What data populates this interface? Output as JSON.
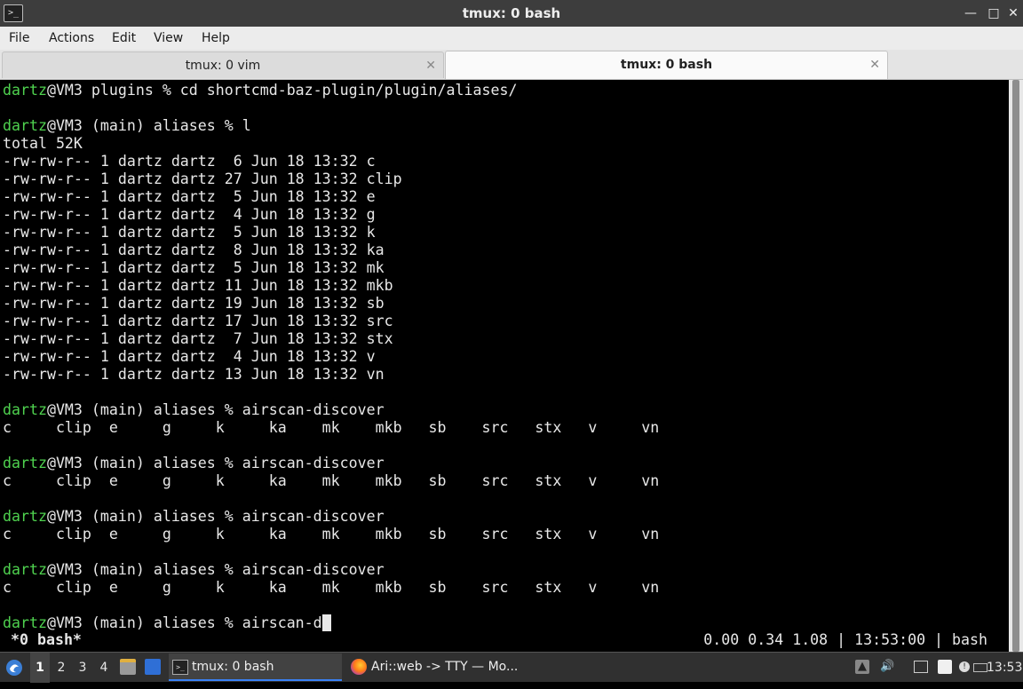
{
  "window": {
    "title": "tmux: 0 bash"
  },
  "menubar": [
    "File",
    "Actions",
    "Edit",
    "View",
    "Help"
  ],
  "tabs": [
    {
      "label": "tmux: 0 vim",
      "active": false
    },
    {
      "label": "tmux: 0 bash",
      "active": true
    }
  ],
  "terminal": {
    "lines": [
      {
        "user": "dartz",
        "rest": "@VM3 plugins % cd shortcmd-baz-plugin/plugin/aliases/"
      },
      {
        "text": ""
      },
      {
        "user": "dartz",
        "rest": "@VM3 (main) aliases % l"
      },
      {
        "text": "total 52K"
      },
      {
        "text": "-rw-rw-r-- 1 dartz dartz  6 Jun 18 13:32 c"
      },
      {
        "text": "-rw-rw-r-- 1 dartz dartz 27 Jun 18 13:32 clip"
      },
      {
        "text": "-rw-rw-r-- 1 dartz dartz  5 Jun 18 13:32 e"
      },
      {
        "text": "-rw-rw-r-- 1 dartz dartz  4 Jun 18 13:32 g"
      },
      {
        "text": "-rw-rw-r-- 1 dartz dartz  5 Jun 18 13:32 k"
      },
      {
        "text": "-rw-rw-r-- 1 dartz dartz  8 Jun 18 13:32 ka"
      },
      {
        "text": "-rw-rw-r-- 1 dartz dartz  5 Jun 18 13:32 mk"
      },
      {
        "text": "-rw-rw-r-- 1 dartz dartz 11 Jun 18 13:32 mkb"
      },
      {
        "text": "-rw-rw-r-- 1 dartz dartz 19 Jun 18 13:32 sb"
      },
      {
        "text": "-rw-rw-r-- 1 dartz dartz 17 Jun 18 13:32 src"
      },
      {
        "text": "-rw-rw-r-- 1 dartz dartz  7 Jun 18 13:32 stx"
      },
      {
        "text": "-rw-rw-r-- 1 dartz dartz  4 Jun 18 13:32 v"
      },
      {
        "text": "-rw-rw-r-- 1 dartz dartz 13 Jun 18 13:32 vn"
      },
      {
        "text": ""
      },
      {
        "user": "dartz",
        "rest": "@VM3 (main) aliases % airscan-discover"
      },
      {
        "text": "c     clip  e     g     k     ka    mk    mkb   sb    src   stx   v     vn"
      },
      {
        "text": ""
      },
      {
        "user": "dartz",
        "rest": "@VM3 (main) aliases % airscan-discover"
      },
      {
        "text": "c     clip  e     g     k     ka    mk    mkb   sb    src   stx   v     vn"
      },
      {
        "text": ""
      },
      {
        "user": "dartz",
        "rest": "@VM3 (main) aliases % airscan-discover"
      },
      {
        "text": "c     clip  e     g     k     ka    mk    mkb   sb    src   stx   v     vn"
      },
      {
        "text": ""
      },
      {
        "user": "dartz",
        "rest": "@VM3 (main) aliases % airscan-discover"
      },
      {
        "text": "c     clip  e     g     k     ka    mk    mkb   sb    src   stx   v     vn"
      },
      {
        "text": ""
      },
      {
        "user": "dartz",
        "rest": "@VM3 (main) aliases % airscan-d",
        "cursor": true
      }
    ],
    "status_left": "*0 bash*",
    "status_right": "0.00 0.34 1.08 | 13:53:00 | bash"
  },
  "taskbar": {
    "workspaces": [
      "1",
      "2",
      "3",
      "4"
    ],
    "active_workspace": "1",
    "tasks": [
      {
        "label": "tmux: 0 bash",
        "icon": "terminal-icon",
        "active": true
      },
      {
        "label": "Ari::web -> TTY — Mo...",
        "icon": "firefox-icon",
        "active": false
      }
    ],
    "clock": "13:53"
  },
  "colors": {
    "prompt_user": "#4fd24f",
    "terminal_bg": "#000000",
    "terminal_fg": "#e8e8e8"
  }
}
